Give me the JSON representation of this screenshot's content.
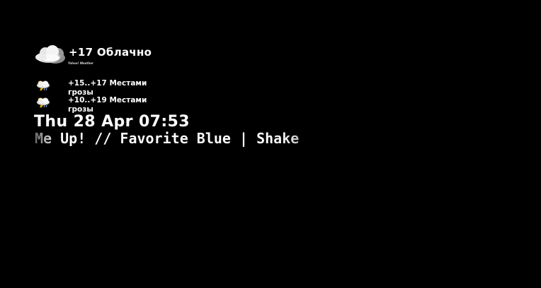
{
  "weather": {
    "current": {
      "text": "+17 Облачно",
      "icon": "cloud-icon"
    },
    "provider": "Yahoo! Weather",
    "forecast": [
      {
        "text": "+15..+17 Местами грозы",
        "icon": "thunderstorm-icon"
      },
      {
        "text": "+10..+19 Местами грозы",
        "icon": "thunderstorm-icon"
      }
    ]
  },
  "clock": {
    "datetime": "Thu 28 Apr 07:53"
  },
  "music": {
    "now_playing": "Me Up! // Favorite Blue | Shake"
  },
  "colors": {
    "background": "#000000",
    "text": "#ffffff"
  }
}
